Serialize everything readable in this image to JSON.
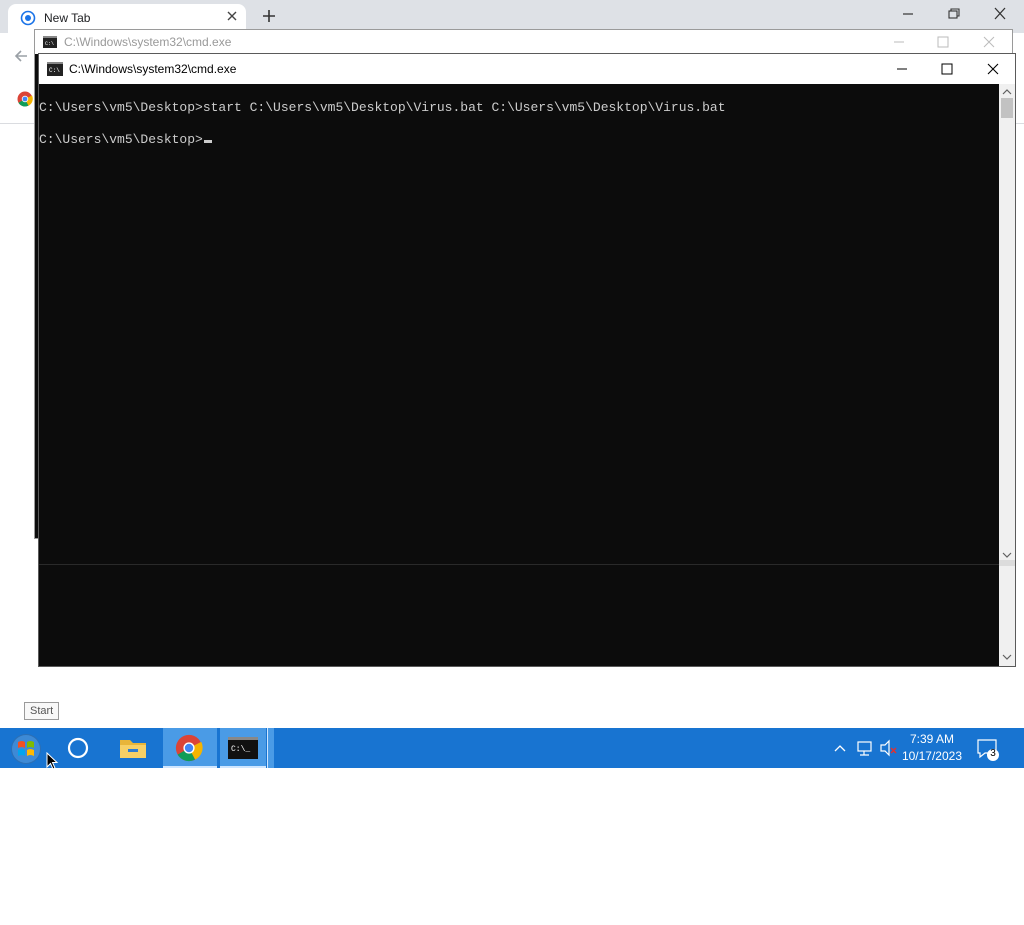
{
  "chrome": {
    "tab_title": "New Tab",
    "tab_icon": "chrome-loading-icon",
    "new_tab_icon": "plus-icon"
  },
  "cmd_back": {
    "title": "C:\\Windows\\system32\\cmd.exe"
  },
  "cmd_front": {
    "title": "C:\\Windows\\system32\\cmd.exe",
    "lines": [
      "C:\\Users\\vm5\\Desktop>start C:\\Users\\vm5\\Desktop\\Virus.bat C:\\Users\\vm5\\Desktop\\Virus.bat",
      "C:\\Users\\vm5\\Desktop>"
    ]
  },
  "tooltip": {
    "start": "Start"
  },
  "taskbar": {
    "items": [
      "windows-start-icon",
      "cortana-icon",
      "file-explorer-icon",
      "chrome-icon",
      "cmd-icon"
    ],
    "tray": {
      "time": "7:39 AM",
      "date": "10/17/2023",
      "notifications": "3"
    }
  },
  "colors": {
    "console_bg": "#0c0c0c",
    "console_text": "#cccccc",
    "taskbar": "#1874d1",
    "chrome_tabstrip": "#dee1e6"
  }
}
